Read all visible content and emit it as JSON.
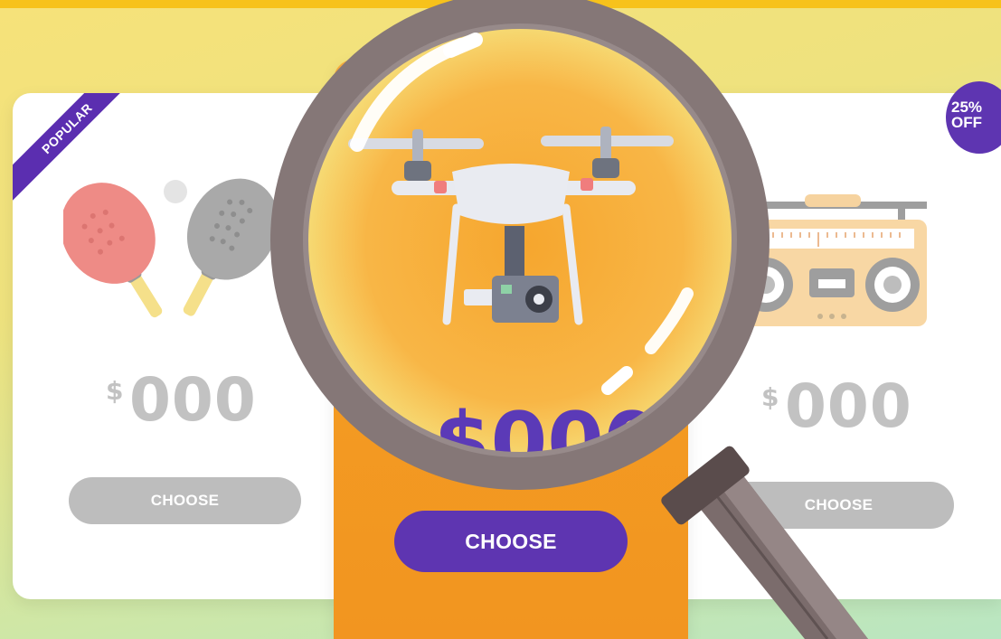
{
  "plans": {
    "left": {
      "ribbon": "POPULAR",
      "currency": "$",
      "price": "000",
      "button": "CHOOSE",
      "image_icon": "ping-pong-paddles-icon"
    },
    "center": {
      "currency": "$",
      "price": "000",
      "button": "CHOOSE",
      "image_icon": "drone-icon"
    },
    "right": {
      "badge_line1": "25%",
      "badge_line2": "OFF",
      "currency": "$",
      "price": "000",
      "button": "CHOOSE",
      "image_icon": "boombox-radio-icon"
    }
  },
  "overlay": {
    "icon": "magnifying-glass-icon"
  },
  "colors": {
    "accent": "#5e35b1",
    "featured_card": "#f39a22",
    "muted_button": "#bdbdbd",
    "muted_price": "#c2c2c2",
    "top_bar": "#f7c21b"
  }
}
